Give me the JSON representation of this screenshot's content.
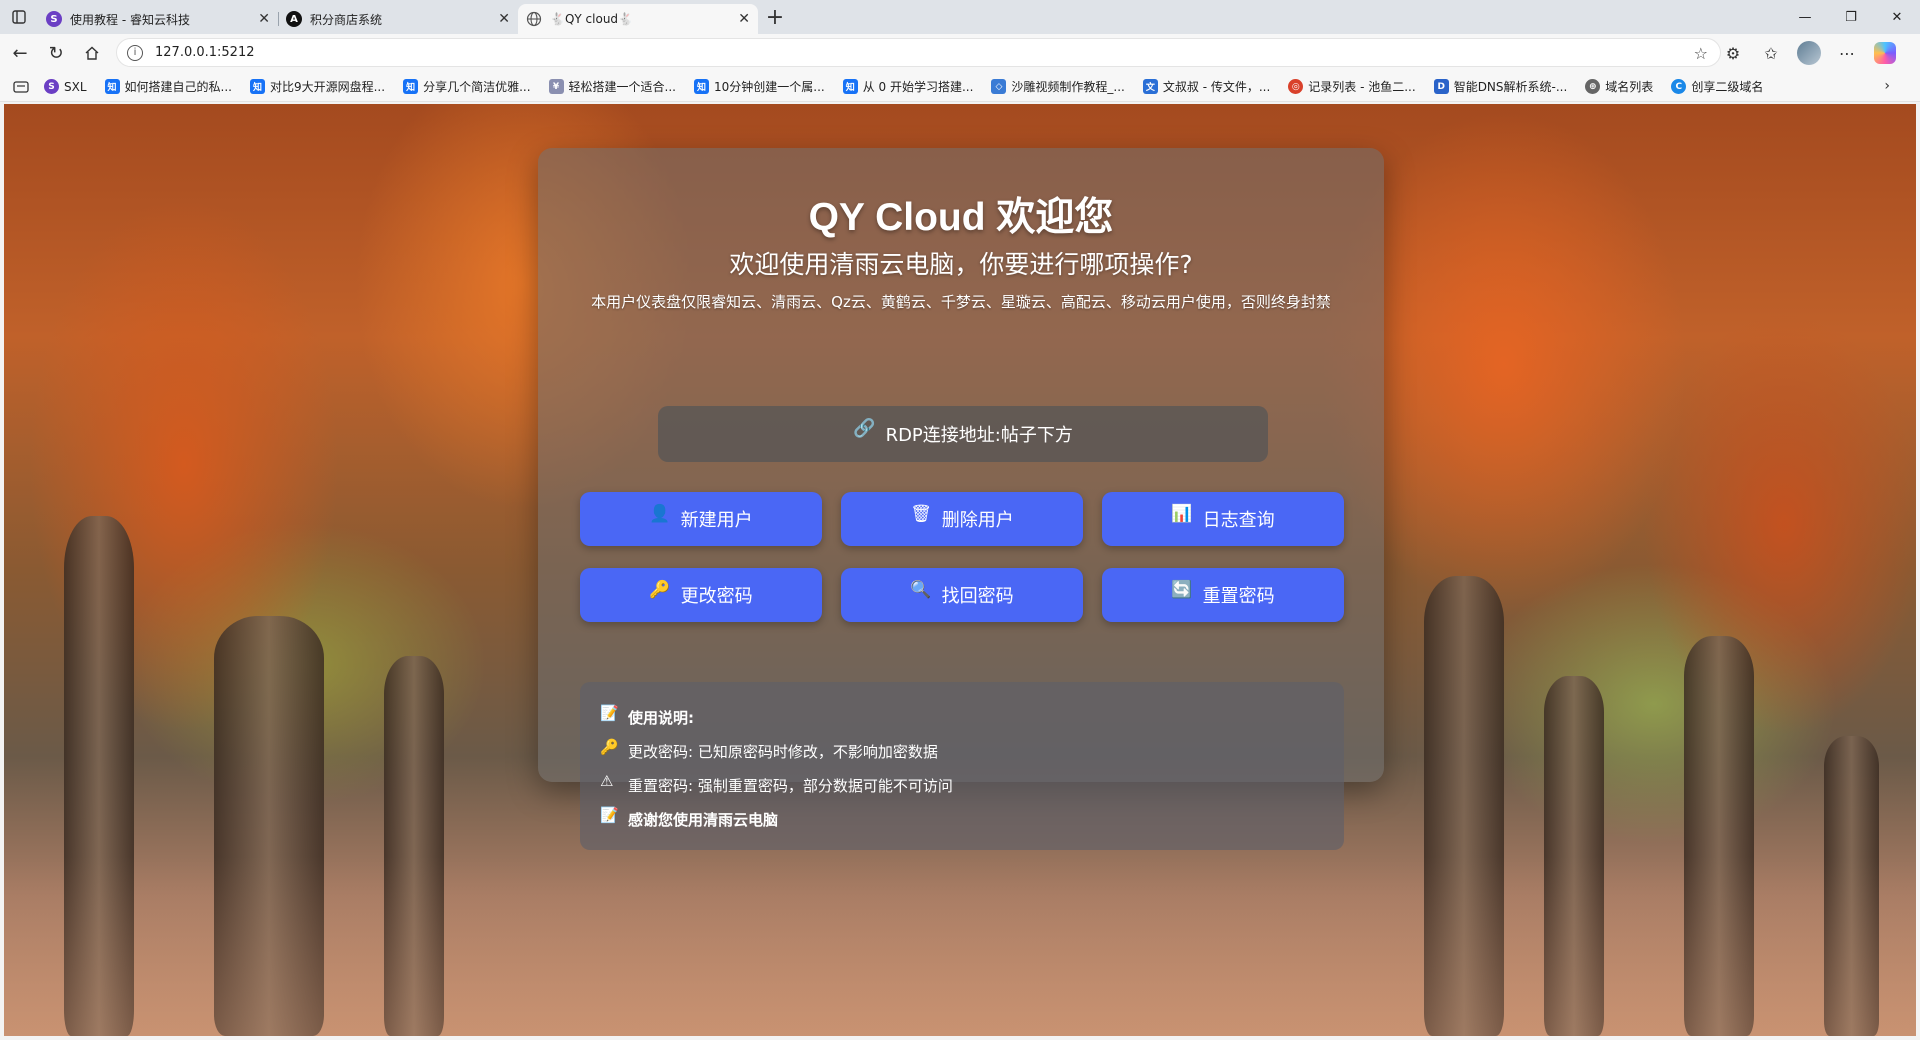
{
  "browser": {
    "tabs": [
      {
        "title": "使用教程 - 睿知云科技",
        "favicon": "S",
        "favicon_color": "#6b3fc4",
        "active": false
      },
      {
        "title": "积分商店系统",
        "favicon": "A",
        "favicon_color": "#111111",
        "active": false
      },
      {
        "title": "QY cloud",
        "favicon": "globe",
        "favicon_color": "#555555",
        "active": true
      }
    ],
    "url": "127.0.0.1:5212",
    "bookmarks": [
      {
        "label": "SXL",
        "icon": "S",
        "color": "#6b3fc4"
      },
      {
        "label": "如何搭建自己的私...",
        "icon": "知",
        "color": "#1772f6"
      },
      {
        "label": "对比9大开源网盘程...",
        "icon": "知",
        "color": "#1772f6"
      },
      {
        "label": "分享几个简洁优雅...",
        "icon": "知",
        "color": "#1772f6"
      },
      {
        "label": "轻松搭建一个适合...",
        "icon": "¥",
        "color": "#8a8fb0"
      },
      {
        "label": "10分钟创建一个属...",
        "icon": "知",
        "color": "#1772f6"
      },
      {
        "label": "从 0 开始学习搭建...",
        "icon": "知",
        "color": "#1772f6"
      },
      {
        "label": "沙雕视频制作教程_...",
        "icon": "◇",
        "color": "#3a7bd5"
      },
      {
        "label": "文叔叔 - 传文件，...",
        "icon": "文",
        "color": "#2a6fd6"
      },
      {
        "label": "记录列表 - 池鱼二...",
        "icon": "◎",
        "color": "#d9412b"
      },
      {
        "label": "智能DNS解析系统-...",
        "icon": "D",
        "color": "#2a63c9"
      },
      {
        "label": "域名列表",
        "icon": "⊕",
        "color": "#666666"
      },
      {
        "label": "创享二级域名",
        "icon": "C",
        "color": "#1a88e8"
      }
    ]
  },
  "page": {
    "title": "QY Cloud 欢迎您",
    "subtitle": "欢迎使用清雨云电脑，你要进行哪项操作?",
    "notice": "本用户仪表盘仅限睿知云、清雨云、Qz云、黄鹤云、千梦云、星璇云、高配云、移动云用户使用，否则终身封禁",
    "rdp_button": {
      "label": "RDP连接地址:帖子下方",
      "icon": "🔗"
    },
    "actions": [
      {
        "label": "新建用户",
        "icon": "👤"
      },
      {
        "label": "删除用户",
        "icon": "🗑"
      },
      {
        "label": "日志查询",
        "icon": "📊"
      },
      {
        "label": "更改密码",
        "icon": "🔑"
      },
      {
        "label": "找回密码",
        "icon": "🔍"
      },
      {
        "label": "重置密码",
        "icon": "🔄"
      }
    ],
    "help": {
      "heading": {
        "icon": "📝",
        "text": "使用说明:"
      },
      "items": [
        {
          "icon": "🔑",
          "text": "更改密码: 已知原密码时修改，不影响加密数据"
        },
        {
          "icon": "⚠",
          "text": "重置密码: 强制重置密码，部分数据可能不可访问"
        }
      ],
      "footer": {
        "icon": "📝",
        "text": "感谢您使用清雨云电脑"
      }
    },
    "colors": {
      "accent": "#4a67f5"
    }
  }
}
